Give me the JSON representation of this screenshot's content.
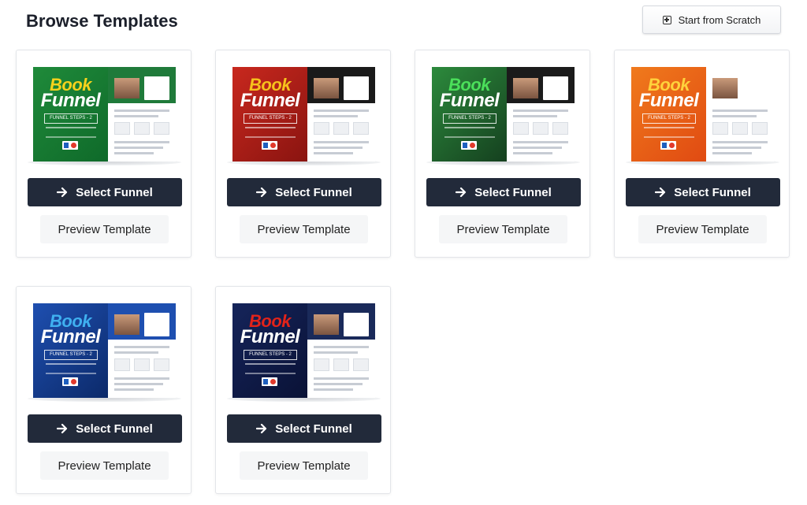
{
  "header": {
    "title": "Browse Templates",
    "scratch_label": "Start from Scratch",
    "scratch_icon": "plus-square-icon"
  },
  "cards": [
    {
      "thumb": {
        "brand_top": "Book",
        "brand_bottom": "Funnel",
        "steps": "FUNNEL STEPS - 2",
        "bg": "#1f8a3a",
        "bg2": "#0f6a2a",
        "accent": "#f6d21c",
        "header_bg": "#1f7a3a"
      },
      "select_label": "Select Funnel",
      "preview_label": "Preview Template"
    },
    {
      "thumb": {
        "brand_top": "Book",
        "brand_bottom": "Funnel",
        "steps": "FUNNEL STEPS - 2",
        "bg": "#c8281e",
        "bg2": "#8a1410",
        "accent": "#f6c21c",
        "header_bg": "#1a1a1a"
      },
      "select_label": "Select Funnel",
      "preview_label": "Preview Template"
    },
    {
      "thumb": {
        "brand_top": "Book",
        "brand_bottom": "Funnel",
        "steps": "FUNNEL STEPS - 2",
        "bg": "#2c8a3c",
        "bg2": "#15401f",
        "accent": "#4be05a",
        "header_bg": "#1b1b1b"
      },
      "select_label": "Select Funnel",
      "preview_label": "Preview Template"
    },
    {
      "thumb": {
        "brand_top": "Book",
        "brand_bottom": "Funnel",
        "steps": "FUNNEL STEPS - 2",
        "bg": "#f07a1c",
        "bg2": "#e04a12",
        "accent": "#ffd23c",
        "header_bg": "#ffffff"
      },
      "select_label": "Select Funnel",
      "preview_label": "Preview Template"
    },
    {
      "thumb": {
        "brand_top": "Book",
        "brand_bottom": "Funnel",
        "steps": "FUNNEL STEPS - 2",
        "bg": "#1e4fb0",
        "bg2": "#0c2a6a",
        "accent": "#3fb0f0",
        "header_bg": "#1e4fb0"
      },
      "select_label": "Select Funnel",
      "preview_label": "Preview Template"
    },
    {
      "thumb": {
        "brand_top": "Book",
        "brand_bottom": "Funnel",
        "steps": "FUNNEL STEPS - 2",
        "bg": "#15245a",
        "bg2": "#0a1236",
        "accent": "#e2231a",
        "header_bg": "#1a2a5a"
      },
      "select_label": "Select Funnel",
      "preview_label": "Preview Template"
    }
  ]
}
